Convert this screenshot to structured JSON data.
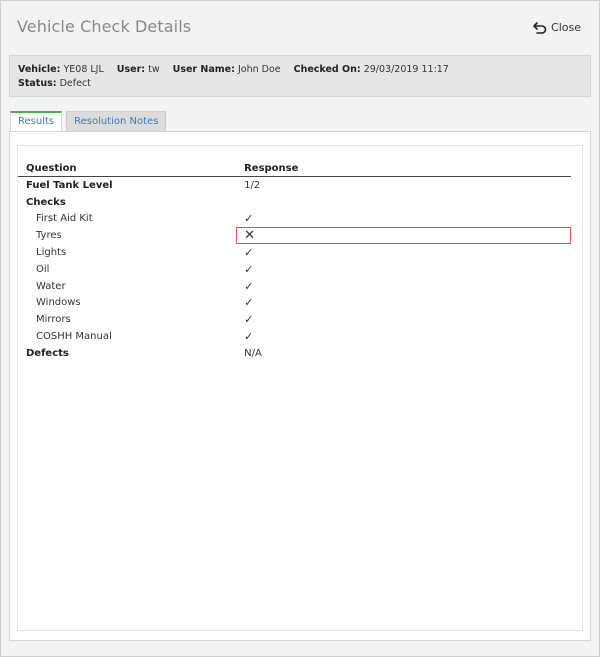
{
  "dialog": {
    "title": "Vehicle Check Details",
    "close_label": "Close"
  },
  "info": {
    "vehicle_label": "Vehicle:",
    "vehicle_value": "YE08 LJL",
    "user_label": "User:",
    "user_value": "tw",
    "user_name_label": "User Name:",
    "user_name_value": "John Doe",
    "checked_on_label": "Checked On:",
    "checked_on_value": "29/03/2019 11:17",
    "status_label": "Status:",
    "status_value": "Defect"
  },
  "tabs": [
    {
      "label": "Results",
      "active": true
    },
    {
      "label": "Resolution Notes",
      "active": false
    }
  ],
  "table": {
    "headers": {
      "question": "Question",
      "response": "Response"
    },
    "rows": [
      {
        "question": "Fuel Tank Level",
        "response": "1/2",
        "kind": "section"
      },
      {
        "question": "Checks",
        "response": "",
        "kind": "section"
      },
      {
        "question": "First Aid Kit",
        "response": "✓",
        "kind": "item"
      },
      {
        "question": "Tyres",
        "response": "✕",
        "kind": "item",
        "defect": true
      },
      {
        "question": "Lights",
        "response": "✓",
        "kind": "item"
      },
      {
        "question": "Oil",
        "response": "✓",
        "kind": "item"
      },
      {
        "question": "Water",
        "response": "✓",
        "kind": "item"
      },
      {
        "question": "Windows",
        "response": "✓",
        "kind": "item"
      },
      {
        "question": "Mirrors",
        "response": "✓",
        "kind": "item"
      },
      {
        "question": "COSHH Manual",
        "response": "✓",
        "kind": "item"
      },
      {
        "question": "Defects",
        "response": "N/A",
        "kind": "section"
      }
    ]
  },
  "icons": {
    "close": "undo-arrow-icon",
    "check": "check-mark-icon",
    "cross": "cross-mark-icon"
  },
  "colors": {
    "tab_accent": "#4caf50",
    "link": "#3a7bbf",
    "defect_outline": "#e05454"
  }
}
